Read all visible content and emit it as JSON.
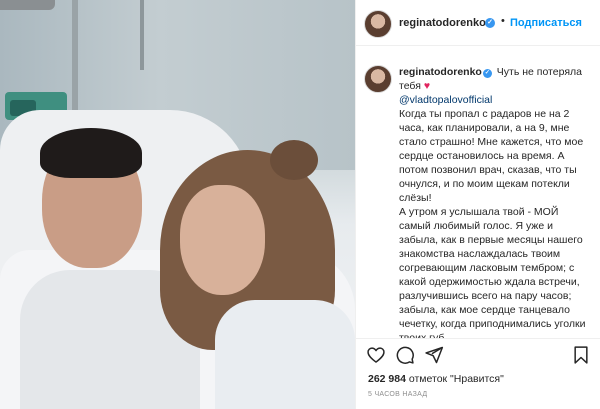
{
  "header": {
    "username": "reginatodorenko",
    "verified_mark": "✓",
    "separator": "•",
    "follow_label": "Подписаться"
  },
  "caption": {
    "username": "reginatodorenko",
    "first_words": "Чуть не потеряла тебя",
    "heart": "♥",
    "mention": "@vladtopalovofficial",
    "paragraph1": "Когда ты пропал с радаров не на 2 часа, как планировали, а на 9, мне стало страшно! Мне кажется, что мое сердце остановилось на время. А потом позвонил врач, сказав, что ты очнулся, и по моим щекам потекли слёзы!",
    "paragraph2": "А утром я услышала твой - МОЙ самый любимый голос. Я уже и забыла, как в первые месяцы нашего знакомства наслаждалась твоим согревающим ласковым тембром; с какой одержимостью ждала встречи, разлучившись всего на пару часов; забыла, как мое сердце танцевало чечетку, когда приподнимались уголки твоих губ."
  },
  "actions": {
    "icons": [
      "heart-icon",
      "comment-icon",
      "share-icon",
      "bookmark-icon"
    ]
  },
  "likes": {
    "count": "262 984",
    "suffix": "отметок \"Нравится\""
  },
  "timestamp": "5 ЧАСОВ НАЗАД",
  "colors": {
    "follow": "#0095f6",
    "verified": "#3897f0",
    "heart": "#e0245e",
    "mention": "#00376b",
    "muted": "#8e8e8e"
  }
}
